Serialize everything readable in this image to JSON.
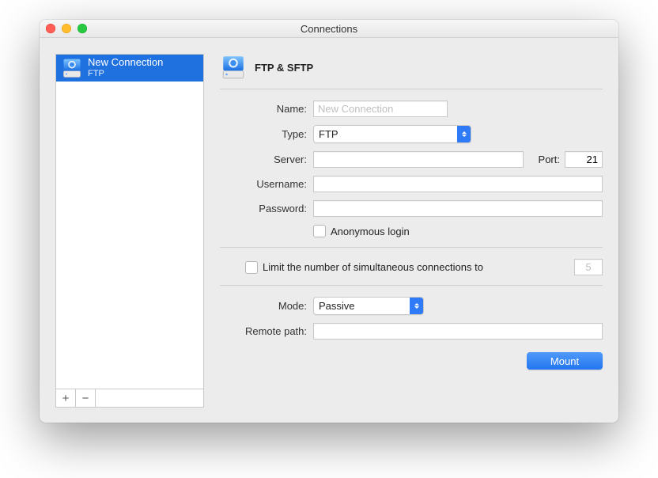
{
  "window": {
    "title": "Connections"
  },
  "sidebar": {
    "items": [
      {
        "title": "New Connection",
        "subtitle": "FTP"
      }
    ],
    "add_button": "+",
    "remove_button": "−"
  },
  "header": {
    "title": "FTP & SFTP"
  },
  "form": {
    "name_label": "Name:",
    "name_placeholder": "New Connection",
    "type_label": "Type:",
    "type_value": "FTP",
    "server_label": "Server:",
    "server_value": "",
    "port_label": "Port:",
    "port_value": "21",
    "username_label": "Username:",
    "username_value": "",
    "password_label": "Password:",
    "password_value": "",
    "anonymous_label": "Anonymous login",
    "limit_label": "Limit the number of simultaneous connections to",
    "limit_value": "5",
    "mode_label": "Mode:",
    "mode_value": "Passive",
    "remote_path_label": "Remote path:",
    "remote_path_value": ""
  },
  "actions": {
    "mount_label": "Mount"
  }
}
